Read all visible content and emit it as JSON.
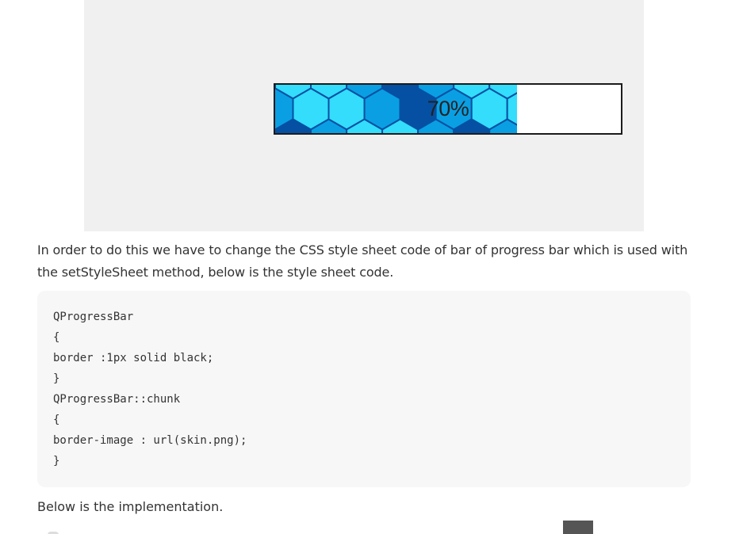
{
  "demo": {
    "progress_value": 70,
    "progress_label": "70%",
    "colors": {
      "chunk_dark": "#0550a3",
      "chunk_mid": "#0a9fe3",
      "chunk_light": "#33ddfb",
      "track": "#ffffff",
      "border": "#1b1b1b"
    }
  },
  "article": {
    "paragraph_1": "In order to do this we have to change the CSS style sheet code of bar of progress bar which is used with the setStyleSheet method, below is the style sheet code.",
    "code_lines": [
      "QProgressBar",
      "{",
      "border :1px solid black;",
      "}",
      "QProgressBar::chunk",
      "{",
      "border-image : url(skin.png);",
      "}"
    ],
    "paragraph_2": "Below is the implementation."
  }
}
